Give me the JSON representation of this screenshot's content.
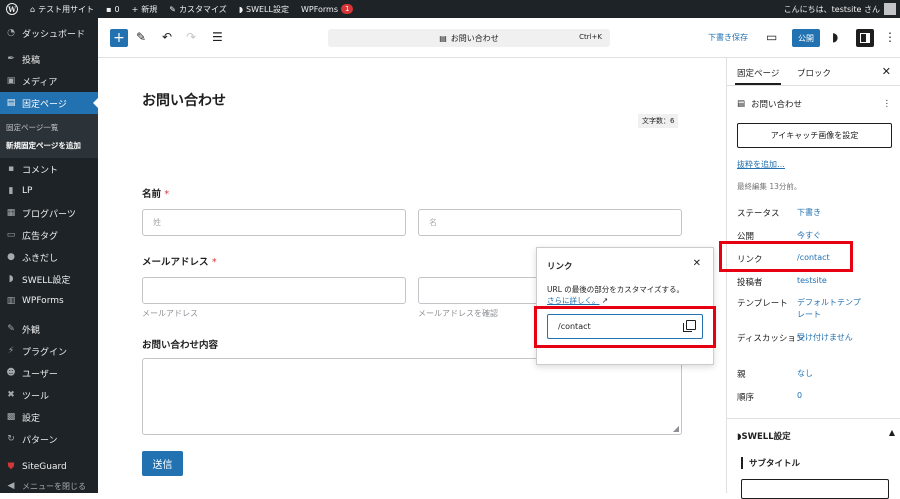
{
  "adminbar": {
    "site_name": "テスト用サイト",
    "comments_count": "0",
    "new_label": "新規",
    "customize_label": "カスタマイズ",
    "swell_label": "SWELL設定",
    "wpforms_label": "WPForms",
    "wpforms_badge": "1",
    "greeting": "こんにちは、testsite さん"
  },
  "sidebar": {
    "items": [
      {
        "label": "ダッシュボード",
        "icon": "dashboard-icon"
      },
      {
        "label": "投稿",
        "icon": "pin-icon"
      },
      {
        "label": "メディア",
        "icon": "media-icon"
      },
      {
        "label": "固定ページ",
        "icon": "page-icon",
        "active": true
      },
      {
        "label": "コメント",
        "icon": "comment-icon"
      },
      {
        "label": "LP",
        "icon": "lp-icon"
      },
      {
        "label": "ブログパーツ",
        "icon": "grid-icon"
      },
      {
        "label": "広告タグ",
        "icon": "ad-icon"
      },
      {
        "label": "ふきだし",
        "icon": "bubble-icon"
      },
      {
        "label": "SWELL設定",
        "icon": "swell-icon"
      },
      {
        "label": "WPForms",
        "icon": "forms-icon"
      },
      {
        "label": "外観",
        "icon": "brush-icon"
      },
      {
        "label": "プラグイン",
        "icon": "plugin-icon"
      },
      {
        "label": "ユーザー",
        "icon": "user-icon"
      },
      {
        "label": "ツール",
        "icon": "wrench-icon"
      },
      {
        "label": "設定",
        "icon": "settings-icon"
      },
      {
        "label": "パターン",
        "icon": "pattern-icon"
      },
      {
        "label": "SiteGuard",
        "icon": "shield-icon"
      }
    ],
    "sub_items": [
      "固定ページ一覧",
      "新規固定ページを追加"
    ],
    "collapse_label": "メニューを閉じる"
  },
  "toolbar": {
    "doc_title": "お問い合わせ",
    "shortcut": "Ctrl+K",
    "save_draft": "下書き保存",
    "publish": "公開"
  },
  "editor": {
    "title": "お問い合わせ",
    "word_count": "文字数：6",
    "name_label": "名前",
    "required_mark": "*",
    "last_name_placeholder": "姓",
    "first_name_placeholder": "名",
    "email_label": "メールアドレス",
    "email_hint": "メールアドレス",
    "email_confirm_hint": "メールアドレスを確認",
    "message_label": "お問い合わせ内容",
    "submit_label": "送信"
  },
  "link_popover": {
    "heading": "リンク",
    "help_text": "URL の最後の部分をカスタマイズする。",
    "learn_more": "さらに詳しく。",
    "slug_value": "/contact"
  },
  "panel": {
    "tab_page": "固定ページ",
    "tab_block": "ブロック",
    "doc_name": "お問い合わせ",
    "featured_image_btn": "アイキャッチ画像を設定",
    "add_excerpt": "抜粋を追加…",
    "last_edited": "最終編集 13分前。",
    "rows": [
      {
        "key": "ステータス",
        "value": "下書き"
      },
      {
        "key": "公開",
        "value": "今すぐ"
      },
      {
        "key": "リンク",
        "value": "/contact"
      },
      {
        "key": "投稿者",
        "value": "testsite"
      },
      {
        "key": "テンプレート",
        "value": "デフォルトテンプレート"
      },
      {
        "key": "ディスカッション",
        "value": "受け付けません"
      },
      {
        "key": "親",
        "value": "なし"
      },
      {
        "key": "順序",
        "value": "0"
      }
    ],
    "swell_heading": "SWELL設定",
    "subtitle_heading": "サブタイトル"
  },
  "colors": {
    "accent": "#2271b1",
    "highlight": "#e60012",
    "admin_dark": "#1d2327"
  }
}
